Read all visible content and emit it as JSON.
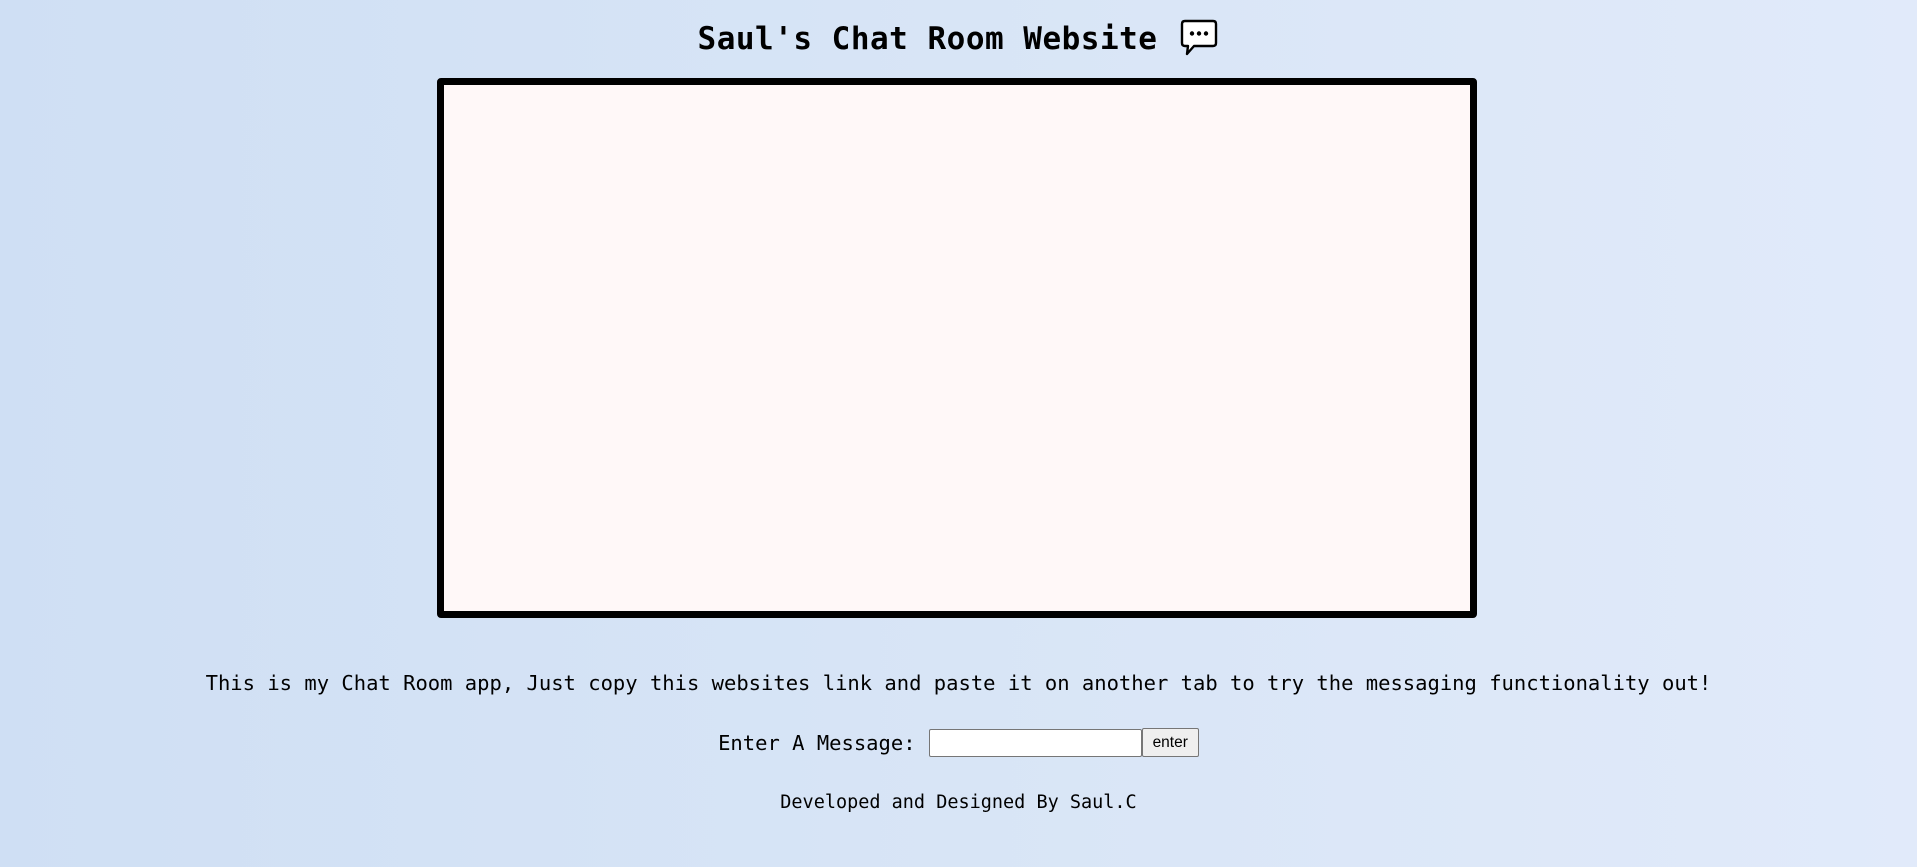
{
  "header": {
    "title": "Saul's Chat Room Website",
    "icon": "speech-bubble-icon"
  },
  "chat_box": {
    "messages": []
  },
  "intro": {
    "text": "This is my Chat Room app, Just copy this websites link and paste it on another tab to try the messaging functionality out!"
  },
  "message_form": {
    "label": "Enter A Message:",
    "input_value": "",
    "input_placeholder": "",
    "submit_label": "enter"
  },
  "footer": {
    "text": "Developed and Designed By Saul.C"
  },
  "colors": {
    "chat_box_background": "#fff8f8",
    "chat_box_border": "#000000",
    "page_background_start": "#cfdff4",
    "page_background_end": "#e1eafa"
  }
}
